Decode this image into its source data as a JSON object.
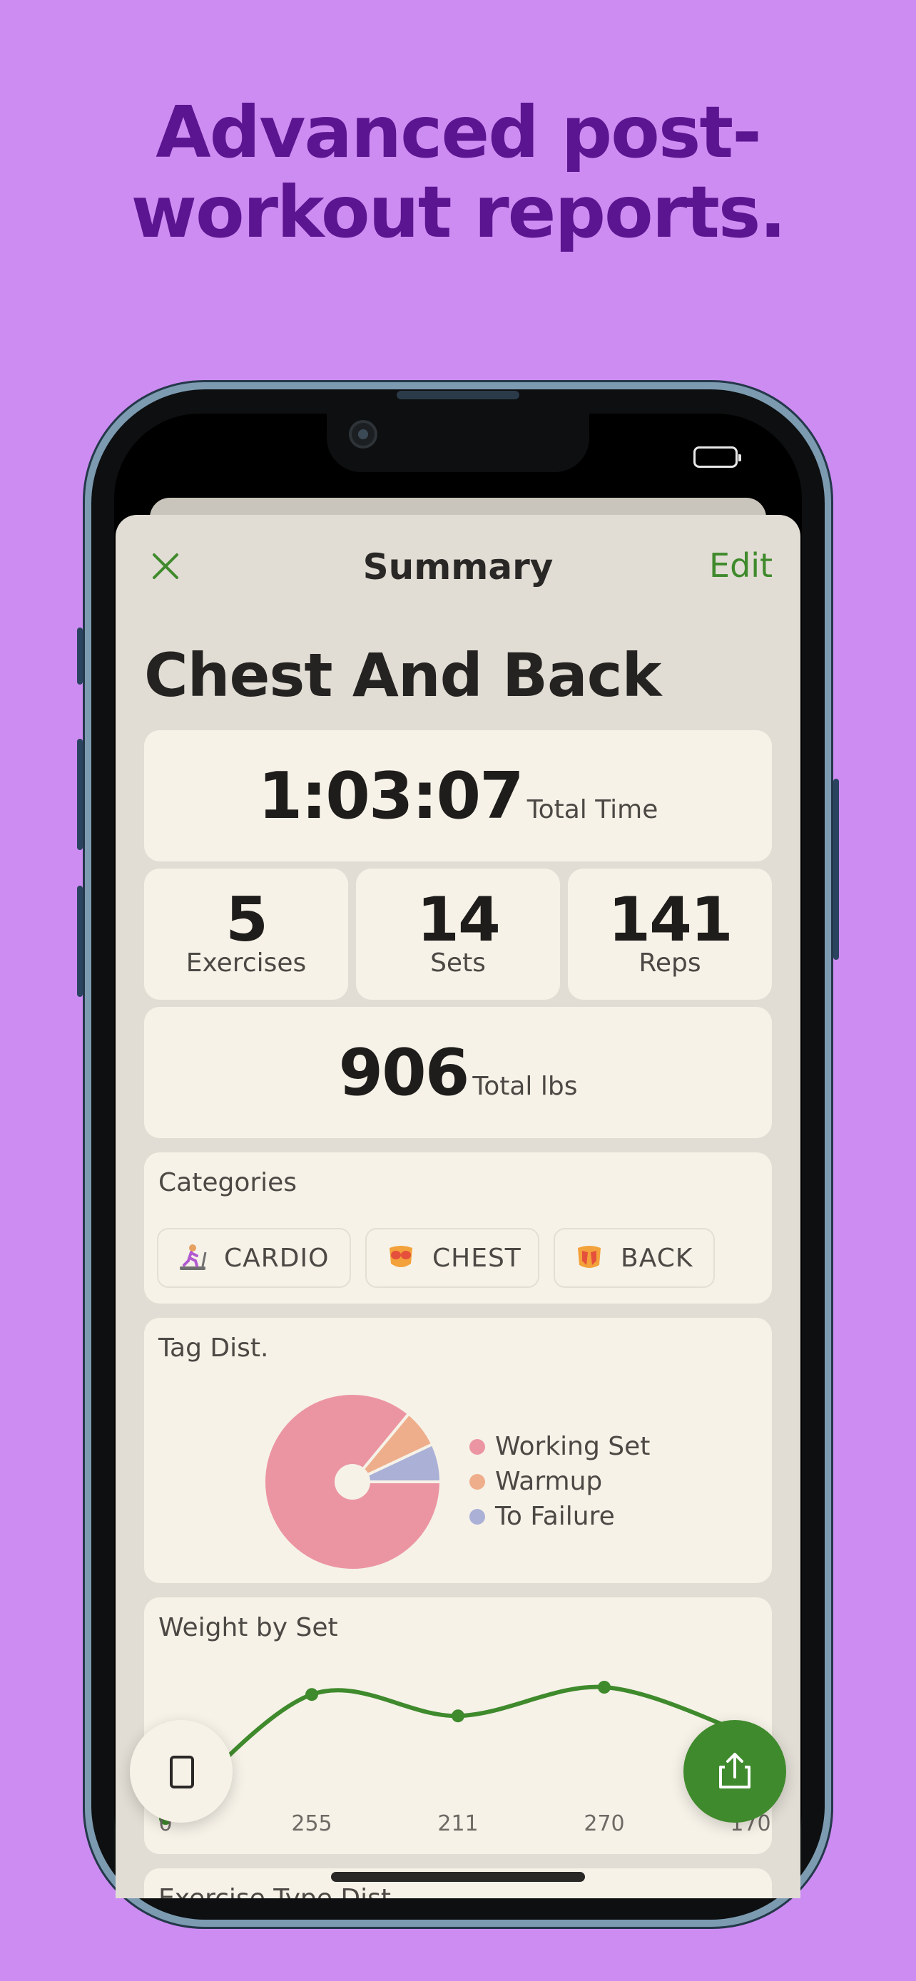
{
  "headline": {
    "line1": "Advanced post-",
    "line2": "workout reports."
  },
  "nav": {
    "title": "Summary",
    "edit_label": "Edit"
  },
  "workout": {
    "title": "Chest And Back"
  },
  "total_time": {
    "value": "1:03:07",
    "label": "Total Time"
  },
  "stats": [
    {
      "value": "5",
      "label": "Exercises"
    },
    {
      "value": "14",
      "label": "Sets"
    },
    {
      "value": "141",
      "label": "Reps"
    }
  ],
  "total_weight": {
    "value": "906",
    "label": "Total lbs"
  },
  "categories": {
    "title": "Categories",
    "items": [
      {
        "label": "CARDIO",
        "icon": "treadmill-runner-icon"
      },
      {
        "label": "CHEST",
        "icon": "chest-muscle-icon"
      },
      {
        "label": "BACK",
        "icon": "back-muscle-icon"
      }
    ]
  },
  "tag_dist": {
    "title": "Tag Dist.",
    "legend": [
      {
        "label": "Working Set",
        "color": "#ec95a2"
      },
      {
        "label": "Warmup",
        "color": "#efae8b"
      },
      {
        "label": "To Failure",
        "color": "#aab0d6"
      }
    ]
  },
  "weight_by_set": {
    "title": "Weight by Set",
    "color": "#3f8a2c"
  },
  "next_section_title": "Exercise Type Dist.",
  "colors": {
    "background": "#cd8cf2",
    "headline": "#5c1590",
    "accent": "#3f8a2c",
    "card": "#f6f2e8",
    "sheet": "#e1ddd4"
  },
  "icons": {
    "close": "close-icon",
    "share": "share-icon",
    "phone": "phone-device-icon"
  },
  "chart_data": [
    {
      "type": "pie",
      "title": "Tag Dist.",
      "categories": [
        "Working Set",
        "Warmup",
        "To Failure"
      ],
      "values": [
        86,
        7,
        7
      ]
    },
    {
      "type": "line",
      "title": "Weight by Set",
      "categories": [
        "0",
        "255",
        "211",
        "270",
        "170"
      ],
      "values": [
        0,
        255,
        211,
        270,
        170
      ],
      "ylim": [
        0,
        270
      ]
    }
  ]
}
